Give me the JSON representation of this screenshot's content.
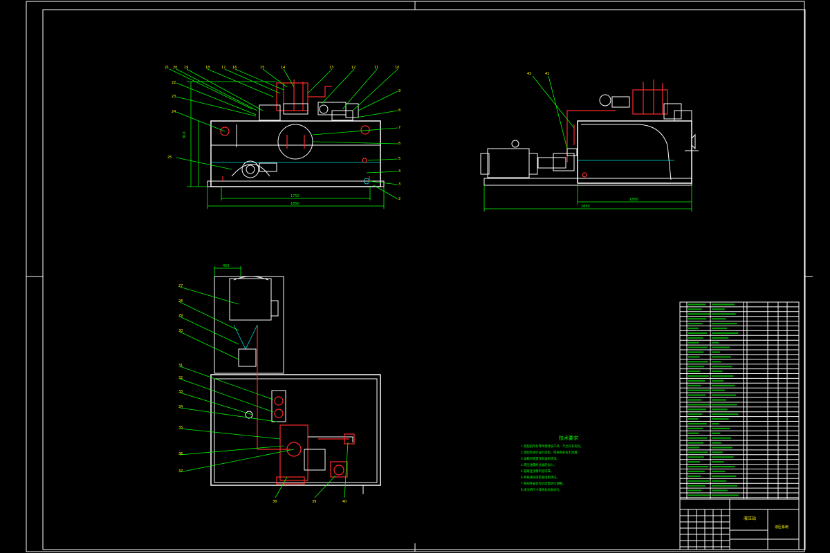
{
  "drawing": {
    "title": "液压站",
    "tech_notes": {
      "heading": "技术要求",
      "lines": [
        "1.装配前所有零件需清洗干净，不允许有毛刺。",
        "2.装配后进行压力试验，检查各处有无渗漏。",
        "3.油箱内壁需涂耐油防锈漆。",
        "4.液压油需经过滤后加入。",
        "5.管路连接需牢固可靠。",
        "6.系统调试前检查电机转向。",
        "7.各阀件安装完毕后需进行调整。",
        "8.未注明尺寸按相关标准执行。"
      ]
    },
    "title_block": {
      "name": "液压站",
      "drawing_no": "液压系统"
    },
    "dims": {
      "front_width": "1750",
      "front_overall": "1850",
      "front_height": "810",
      "side_overall": "2850",
      "side_base": "1800",
      "top_motor": "450"
    }
  }
}
